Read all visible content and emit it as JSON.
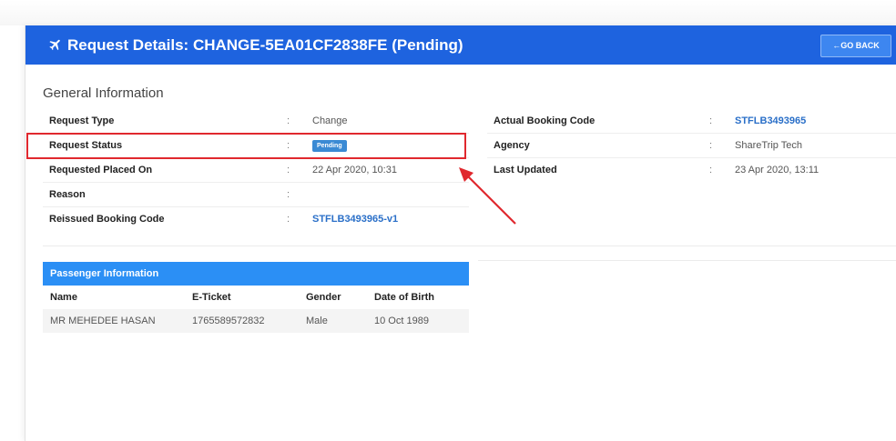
{
  "header": {
    "title_prefix": "Request Details: ",
    "request_id": "CHANGE-5EA01CF2838FE",
    "status": "(Pending)",
    "back_button": "GO BACK",
    "color": "#1e63df"
  },
  "general": {
    "section_title": "General Information",
    "colon": ":",
    "left_rows": [
      {
        "label": "Request Type",
        "value": "Change"
      },
      {
        "label": "Request Status",
        "badge": "Pending"
      },
      {
        "label": "Requested Placed On",
        "value": "22 Apr 2020, 10:31"
      },
      {
        "label": "Reason",
        "value": ""
      },
      {
        "label": "Reissued Booking Code",
        "value": "STFLB3493965-v1"
      }
    ],
    "right_rows": [
      {
        "label": "Actual Booking Code",
        "value": "STFLB3493965"
      },
      {
        "label": "Agency",
        "value": "ShareTrip Tech"
      },
      {
        "label": "Last Updated",
        "value": "23 Apr 2020, 13:11"
      }
    ]
  },
  "passenger": {
    "title": "Passenger Information",
    "columns": [
      "Name",
      "E-Ticket",
      "Gender",
      "Date of Birth"
    ],
    "rows": [
      [
        "MR MEHEDEE HASAN",
        "1765589572832",
        "Male",
        "10 Oct 1989"
      ]
    ]
  },
  "annotation": {
    "highlight_color": "#e0282e"
  }
}
